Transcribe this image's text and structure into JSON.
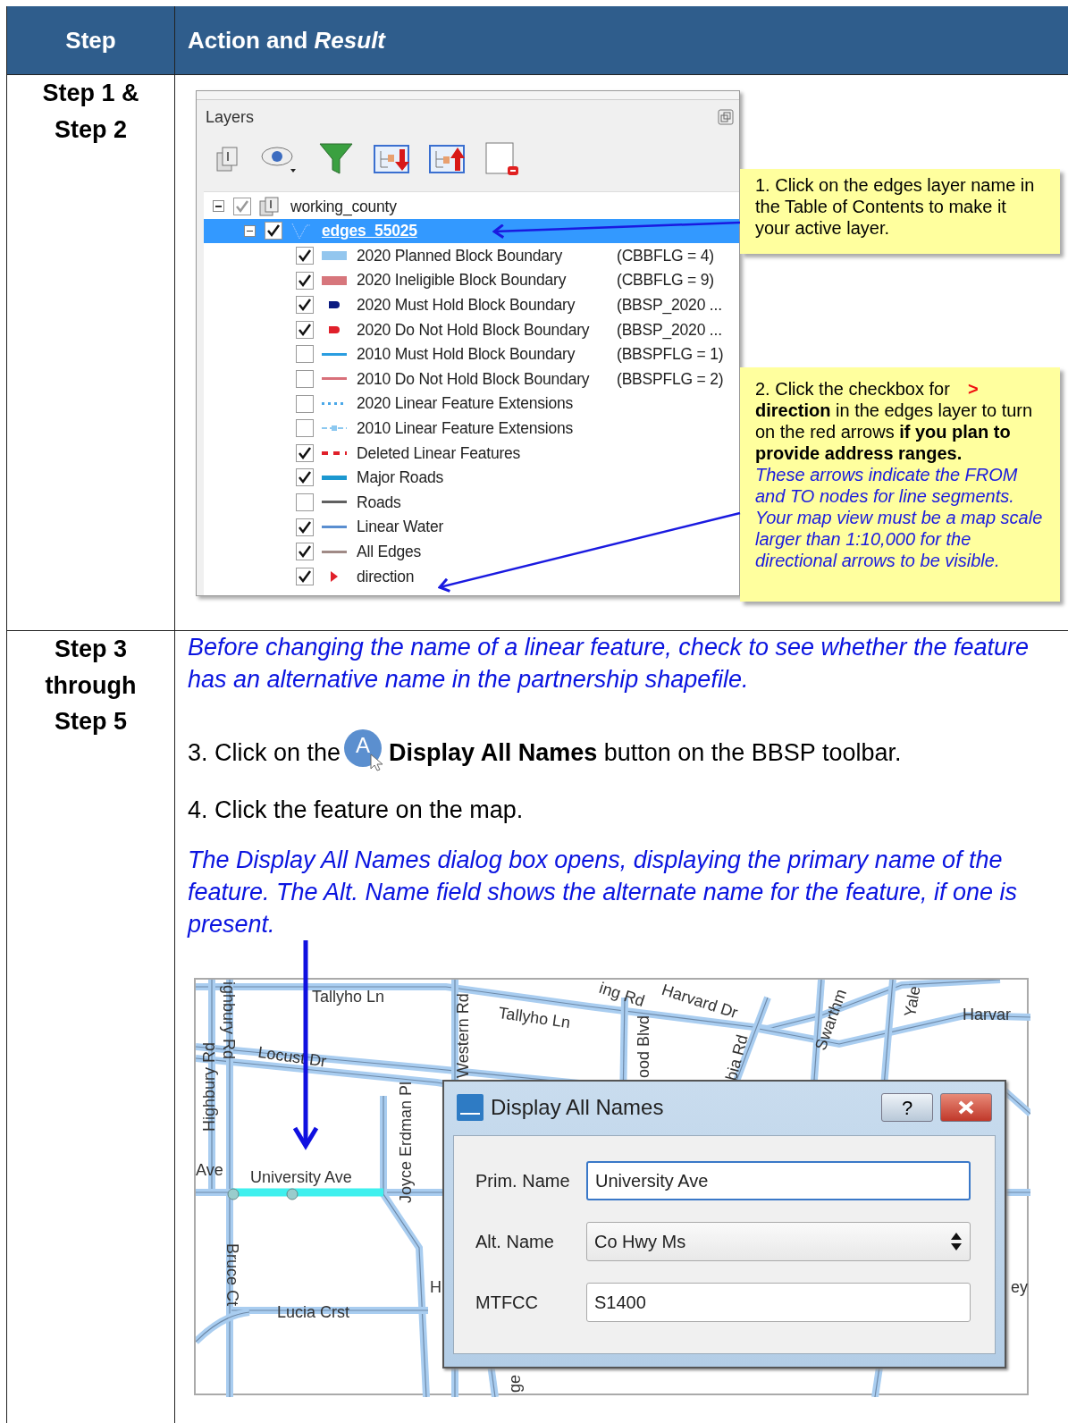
{
  "table": {
    "columns": [
      "Step",
      "Action and *Result*"
    ]
  },
  "row_1": {
    "step_lines": [
      "Step 1 &",
      "Step 2"
    ],
    "layers_panel": {
      "title": "Layers",
      "tree": [
        {
          "label": "working_county",
          "kind": "group",
          "checked": true,
          "expanded": true,
          "selected": false,
          "children": [
            {
              "label": "edges_55025",
              "kind": "layer",
              "checked": true,
              "expanded": true,
              "selected": true,
              "children": [
                {
                  "label": "2020 Planned Block Boundary",
                  "query": "(CBBFLG = 4)",
                  "kind": "fill",
                  "color": "#93c6ee",
                  "checked": true
                },
                {
                  "label": "2020 Ineligible Block Boundary",
                  "query": "(CBBFLG = 9)",
                  "kind": "fill",
                  "color": "#d7767c",
                  "checked": true
                },
                {
                  "label": "2020 Must Hold Block Boundary",
                  "query": "(BBSP_2020 ...",
                  "kind": "pill",
                  "color": "#0a1a80",
                  "checked": true
                },
                {
                  "label": "2020 Do Not Hold Block Boundary",
                  "query": "(BBSP_2020 ...",
                  "kind": "pill",
                  "color": "#e0202a",
                  "checked": true
                },
                {
                  "label": "2010 Must Hold Block Boundary",
                  "query": "(BBSPFLG = 1)",
                  "kind": "line",
                  "color": "#2a9de0",
                  "checked": false
                },
                {
                  "label": "2010 Do Not Hold Block Boundary",
                  "query": "(BBSPFLG = 2)",
                  "kind": "line",
                  "color": "#d8707a",
                  "checked": false
                },
                {
                  "label": "2020 Linear Feature Extensions",
                  "kind": "dotted",
                  "color": "#4aa8e8",
                  "checked": false
                },
                {
                  "label": "2010 Linear Feature Extensions",
                  "kind": "dashdot",
                  "color": "#8cc8f0",
                  "checked": false
                },
                {
                  "label": "Deleted Linear Features",
                  "kind": "dashed",
                  "color": "#e0202a",
                  "checked": true
                },
                {
                  "label": "Major Roads",
                  "kind": "thick",
                  "color": "#1c98d0",
                  "checked": true
                },
                {
                  "label": "Roads",
                  "kind": "line",
                  "color": "#606060",
                  "checked": false
                },
                {
                  "label": "Linear Water",
                  "kind": "line",
                  "color": "#5a8ed0",
                  "checked": true
                },
                {
                  "label": "All Edges",
                  "kind": "line",
                  "color": "#a08a86",
                  "checked": true
                },
                {
                  "label": "direction",
                  "kind": "chevron",
                  "color": "#e0202a",
                  "checked": true
                }
              ]
            }
          ]
        }
      ]
    },
    "callout_1": {
      "text": "1. Click on the edges layer name in the Table of Contents to make it your active layer."
    },
    "callout_2": {
      "intro": "2. Click the checkbox for",
      "glyph": ">",
      "body": "**direction** in the edges layer to turn on the red arrows **if you plan to provide address ranges.**",
      "note": "These arrows indicate the FROM and TO nodes for line segments. Your map view must be a map scale larger than 1:10,000 for the directional arrows to be visible."
    }
  },
  "row_2": {
    "step_lines": [
      "Step 3",
      "through",
      "Step 5"
    ],
    "note_1": "Before changing the name of a linear feature, check to see whether the feature has an alternative name in the partnership shapefile.",
    "instruction_3": {
      "before": "3. Click on the",
      "icon_letter": "A",
      "after": "**Display All Names** button on the BBSP toolbar."
    },
    "instruction_4": "4. Click the feature on the map.",
    "note_2": "The Display All Names dialog box opens, displaying the primary name of the feature. The Alt. Name field shows the alternate name for the feature, if one is present.",
    "map": {
      "labels": [
        "Tallyho Ln",
        "Tallyho Ln",
        "ighbury Rd",
        "Highbury Rd",
        "Locust Dr",
        "Western Rd",
        "ing Rd",
        "Harvard Dr",
        "ood Blvd",
        "bia Rd",
        "Swarthm",
        "Yale",
        "Harvar",
        "Joyce Erdman Pl",
        "Ave",
        "University Ave",
        "Bruce Ct",
        "Lucia Crst",
        "H",
        "ey",
        "ge"
      ],
      "dialog": {
        "title": "Display All Names",
        "help_glyph": "?",
        "fields": [
          {
            "label": "Prim. Name",
            "value": "University Ave",
            "kind": "text",
            "focused": true
          },
          {
            "label": "Alt. Name",
            "value": "Co Hwy Ms",
            "kind": "spin",
            "focused": false
          },
          {
            "label": "MTFCC",
            "value": "S1400",
            "kind": "text",
            "focused": false
          }
        ]
      }
    }
  }
}
